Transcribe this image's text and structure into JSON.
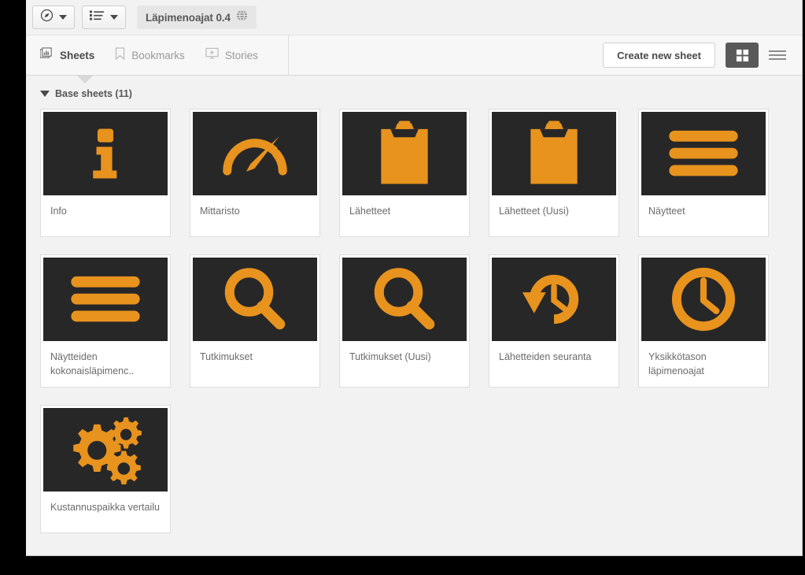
{
  "window": {
    "background_color": "#f2f2f2",
    "desktop_color": "#000000"
  },
  "colors": {
    "accent_orange": "#E8931E",
    "thumb_background": "#272727",
    "toolbar_text": "#4a4a4a",
    "muted_text": "#9a9a9a"
  },
  "topbar": {
    "nav_button": {
      "icon": "compass-icon",
      "caret": "chevron-down-icon"
    },
    "sheets_button": {
      "icon": "list-icon",
      "caret": "chevron-down-icon"
    },
    "app_title": "Läpimenoajat 0.4",
    "app_published_icon": "globe-icon"
  },
  "tabs": [
    {
      "label": "Sheets",
      "icon": "sheets-icon",
      "active": true
    },
    {
      "label": "Bookmarks",
      "icon": "bookmark-icon",
      "active": false
    },
    {
      "label": "Stories",
      "icon": "story-icon",
      "active": false
    }
  ],
  "toolbar": {
    "create_sheet_label": "Create new sheet",
    "grid_view": {
      "icon": "grid-view-icon",
      "active": true
    },
    "list_view": {
      "icon": "list-view-icon",
      "active": false
    }
  },
  "section": {
    "title": "Base sheets (11)",
    "collapse_icon": "triangle-down-icon",
    "expanded": true,
    "count": 11
  },
  "sheets": [
    {
      "title": "Info",
      "icon": "info-letter-icon"
    },
    {
      "title": "Mittaristo",
      "icon": "gauge-icon"
    },
    {
      "title": "Lähetteet",
      "icon": "clipboard-icon"
    },
    {
      "title": "Lähetteet (Uusi)",
      "icon": "clipboard-icon"
    },
    {
      "title": "Näytteet",
      "icon": "three-bars-icon"
    },
    {
      "title": "Näytteiden kokonaisläpimenc..",
      "icon": "three-bars-icon"
    },
    {
      "title": "Tutkimukset",
      "icon": "magnifier-icon"
    },
    {
      "title": "Tutkimukset (Uusi)",
      "icon": "magnifier-icon"
    },
    {
      "title": "Lähetteiden seuranta",
      "icon": "clock-history-icon"
    },
    {
      "title": "Yksikkötason läpimenoajat",
      "icon": "clock-icon"
    },
    {
      "title": "Kustannuspaikka vertailu",
      "icon": "gears-icon"
    }
  ]
}
